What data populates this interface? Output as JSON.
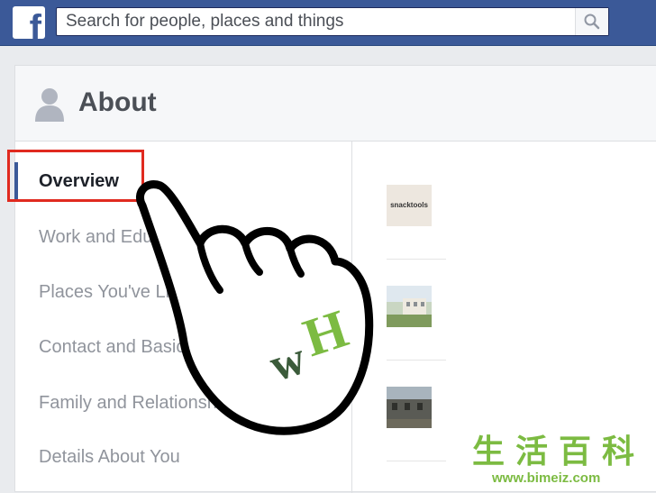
{
  "header": {
    "logo_letter": "f",
    "search_placeholder": "Search for people, places and things"
  },
  "about": {
    "title": "About",
    "nav_items": [
      {
        "label": "Overview",
        "active": true
      },
      {
        "label": "Work and Education",
        "active": false
      },
      {
        "label": "Places You've Lived",
        "active": false
      },
      {
        "label": "Contact and Basic Info",
        "active": false
      },
      {
        "label": "Family and Relationships",
        "active": false
      },
      {
        "label": "Details About You",
        "active": false
      }
    ],
    "content_items": [
      {
        "thumb_text": "snacktools"
      }
    ]
  },
  "overlay": {
    "logo_text_w": "w",
    "logo_text_h": "H"
  },
  "watermark": {
    "chars": "生活百科",
    "url": "www.bimeiz.com"
  },
  "colors": {
    "brand": "#3b5998",
    "highlight": "#e02a1f",
    "wikihow_green": "#7cbb42",
    "wikihow_dark": "#3b5b3a"
  }
}
